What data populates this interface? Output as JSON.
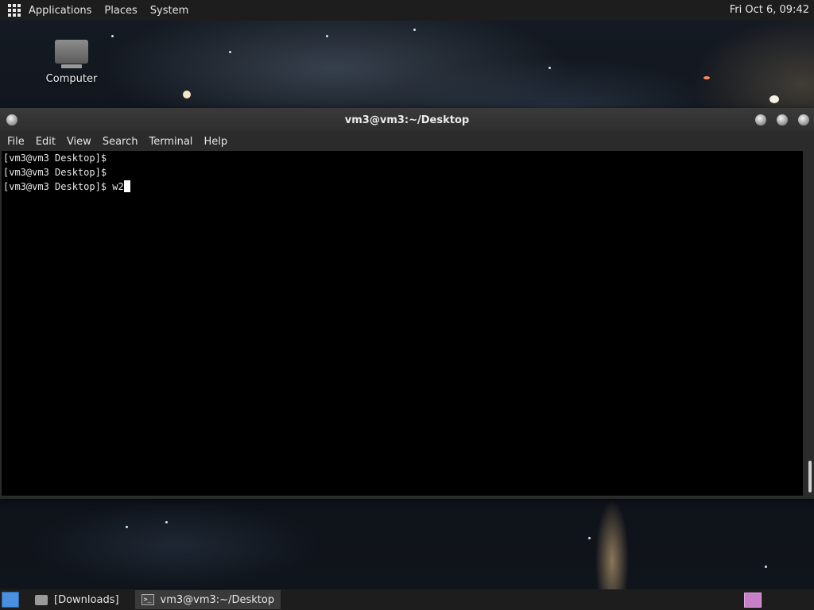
{
  "top_panel": {
    "apps_label": "Applications",
    "places_label": "Places",
    "system_label": "System",
    "clock": "Fri Oct  6, 09:42"
  },
  "desktop": {
    "icons": [
      {
        "label": "Computer",
        "icon": "computer-icon"
      }
    ]
  },
  "window": {
    "title": "vm3@vm3:~/Desktop",
    "menu": [
      "File",
      "Edit",
      "View",
      "Search",
      "Terminal",
      "Help"
    ],
    "lines": [
      "[vm3@vm3 Desktop]$",
      "[vm3@vm3 Desktop]$",
      "[vm3@vm3 Desktop]$ w2"
    ]
  },
  "taskbar": {
    "tasks": [
      {
        "label": "[Downloads]",
        "icon": "folder-icon"
      },
      {
        "label": "vm3@vm3:~/Desktop",
        "icon": "terminal-icon"
      }
    ]
  },
  "colors": {
    "panel": "#1d1d1d",
    "terminal_bg": "#000000",
    "workspace": "#c77fc7",
    "show_desktop": "#4a8fe0"
  }
}
